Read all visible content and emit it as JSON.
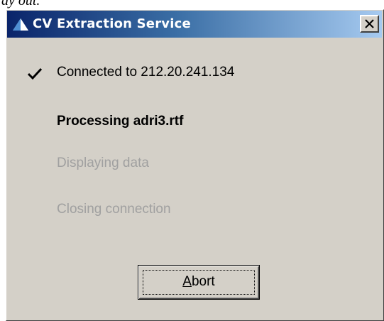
{
  "cropped_text": "ay out.",
  "window": {
    "title": "CV Extraction Service",
    "app_icon": "blue-triangle-icon",
    "close_icon": "close-icon"
  },
  "status_steps": [
    {
      "label": "Connected to 212.20.241.134",
      "state": "done",
      "icon": "checkmark-icon"
    },
    {
      "label": "Processing adri3.rtf",
      "state": "active"
    },
    {
      "label": "Displaying data",
      "state": "pending"
    },
    {
      "label": "Closing connection",
      "state": "pending"
    }
  ],
  "abort_button": {
    "mnemonic": "A",
    "rest": "bort"
  },
  "colors": {
    "title_gradient_start": "#0a246a",
    "title_gradient_end": "#a6caf0",
    "dialog_face": "#d4d0c8",
    "pending_text": "#a0a0a0"
  }
}
